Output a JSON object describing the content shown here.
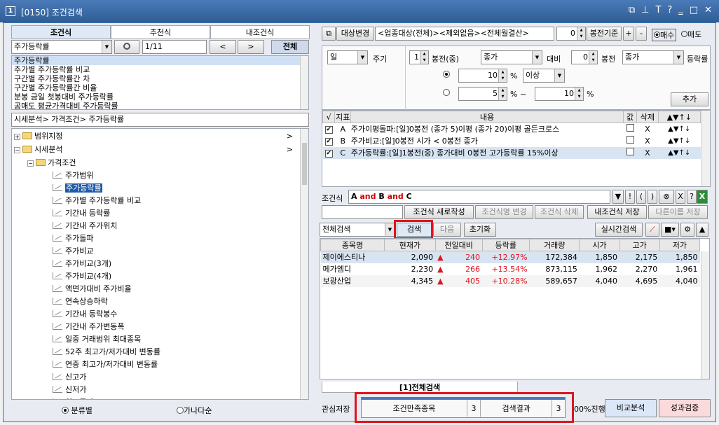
{
  "window": {
    "number": "1",
    "title": "[0150] 조건검색",
    "controls": [
      "⧉",
      "⊥",
      "T",
      "?",
      "‗",
      "□",
      "✕"
    ]
  },
  "left": {
    "tabs": [
      "조건식",
      "추천식",
      "내조건식"
    ],
    "category": "주가등락률",
    "page": "1/11",
    "prev": "<",
    "next": ">",
    "all": "전체",
    "list": [
      "주가등락률",
      "주가별 주가등락률 비교",
      "구간별 주가등락률간 차",
      "구간별 주가등락률간 비율",
      "분봉 금일 첫봉대비 주가등락률",
      "공매도 평균가격대비 주가등락률"
    ],
    "path": "시세분석> 가격조건> 주가등락률",
    "tree_top": [
      {
        "label": "범위지정",
        "arrow": ">"
      },
      {
        "label": "시세분석",
        "arrow": ">"
      }
    ],
    "tree_sub": "가격조건",
    "leaves": [
      "주가범위",
      "주가등락률",
      "주가별 주가등락률 비교",
      "기간내 등락률",
      "기간내 주가위치",
      "주가돌파",
      "주가비교",
      "주가비교(3개)",
      "주가비교(4개)",
      "액면가대비 주가비율",
      "연속상승하락",
      "기간내 등락봉수",
      "기간내 주가변동폭",
      "일중 거래범위 최대종목",
      "52주 최고가/저가대비 변동률",
      "연중 최고가/저가대비 변동률",
      "신고가",
      "신저가",
      "최고주가"
    ],
    "radio_group": "분류별",
    "radio_abc": "가나다순"
  },
  "right": {
    "target_btn": "대상변경",
    "target_text": "<업종대상(전체)><제외없음><전체월결산>",
    "bong_val": "0",
    "bong_label": "봉전기준",
    "plus": "+",
    "minus": "-",
    "buy": "매수",
    "sell": "매도",
    "period": "일",
    "period_label": "주기",
    "n1": "1",
    "bong_mid": "봉전(중)",
    "price1": "종가",
    "vs": "대비",
    "n2": "0",
    "bong": "봉전",
    "price2": "종가",
    "rate": "등락률",
    "v1": "10",
    "pct": "%",
    "op1": "이상",
    "v2": "5",
    "pct_tilde": "% ~",
    "v3": "10",
    "pct2": "%",
    "add": "추가",
    "cond_header": [
      "√",
      "지표",
      "내용",
      "값",
      "삭제",
      "▲▼↑↓"
    ],
    "conds": [
      {
        "id": "A",
        "text": "주가이평돌파:[일]0봉전 (종가 5)이평 (종가 20)이평 골든크로스",
        "del": "X"
      },
      {
        "id": "B",
        "text": "주가비교:[일]0봉전 시가 < 0봉전 종가",
        "del": "X"
      },
      {
        "id": "C",
        "text": "주가등락률:[일]1봉전(중) 종가대비 0봉전 고가등락률 15%이상",
        "del": "X"
      }
    ],
    "formula_label": "조건식",
    "formula": [
      "A",
      "and",
      "B",
      "and",
      "C"
    ],
    "formula_btns": [
      "!",
      "(",
      ")",
      "⊗",
      "X",
      "?"
    ],
    "new_btn": "조건식 새로작성",
    "rename_btn": "조건식명 변경",
    "delete_btn": "조건식 삭제",
    "save_btn": "내조건식 저장",
    "saveas_btn": "다른이름 저장",
    "scope": "전체검색",
    "search_btn": "검색",
    "next_btn": "다음",
    "reset_btn": "초기화",
    "realtime_btn": "실시간검색",
    "res_header": [
      "종목명",
      "현재가",
      "전일대비",
      "등락률",
      "거래량",
      "시가",
      "고가",
      "저가"
    ],
    "results": [
      [
        "제이에스티나",
        "2,090",
        "240",
        "+12.97%",
        "172,384",
        "1,850",
        "2,175",
        "1,850"
      ],
      [
        "메가엠디",
        "2,230",
        "266",
        "+13.54%",
        "873,115",
        "1,962",
        "2,270",
        "1,961"
      ],
      [
        "보광산업",
        "4,345",
        "405",
        "+10.28%",
        "589,657",
        "4,040",
        "4,695",
        "4,040"
      ]
    ],
    "result_tab": "[1]전체검색",
    "interest_label": "관심저장",
    "match_label": "조건만족종목",
    "match_count": "3",
    "result_label": "검색결과",
    "result_count": "3",
    "progress": "00%진행",
    "compare_btn": "비교분석",
    "perf_btn": "성과검증"
  },
  "colors": {
    "up": "#e0141e",
    "highlight": "#e0141e",
    "accent": "#3a6ea5"
  }
}
